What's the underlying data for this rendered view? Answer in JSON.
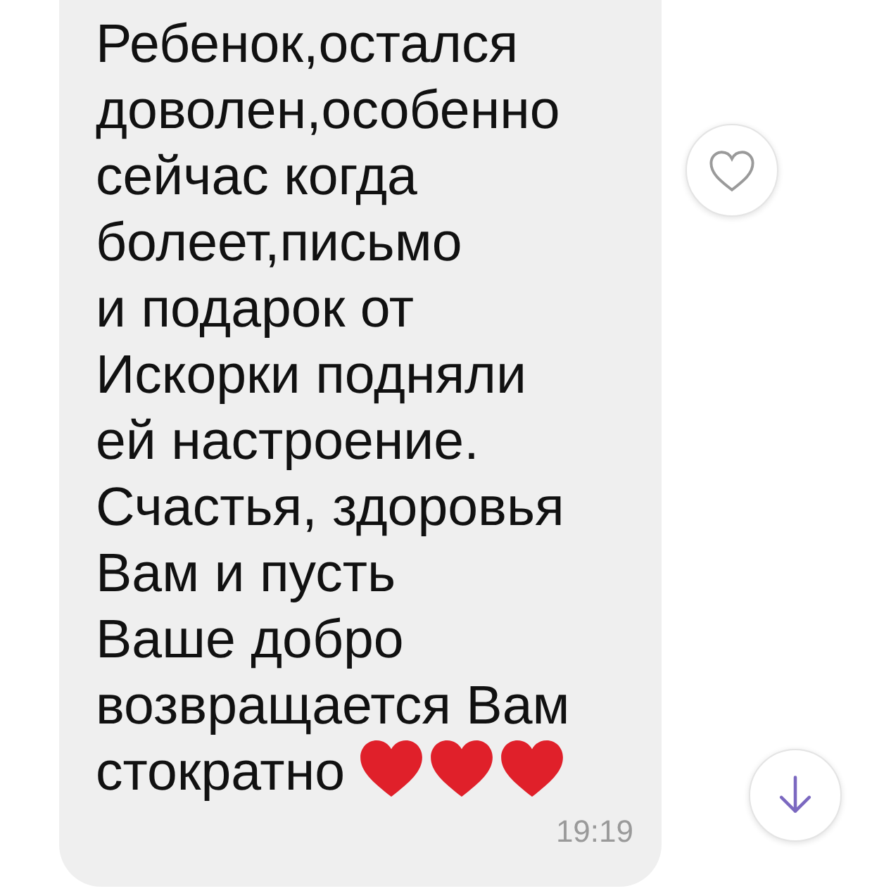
{
  "message": {
    "text": "Ребенок,остался\nдоволен,особенно\nсейчас когда\nболеет,письмо\nи подарок от\nИскорки подняли\nей настроение.\nСчастья, здоровья\nВам и пусть\nВаше добро\nвозвращается Вам\nстократно",
    "hearts": [
      {
        "color": "#e0202a"
      },
      {
        "color": "#e0202a"
      },
      {
        "color": "#e0202a"
      }
    ],
    "time": "19:19"
  }
}
